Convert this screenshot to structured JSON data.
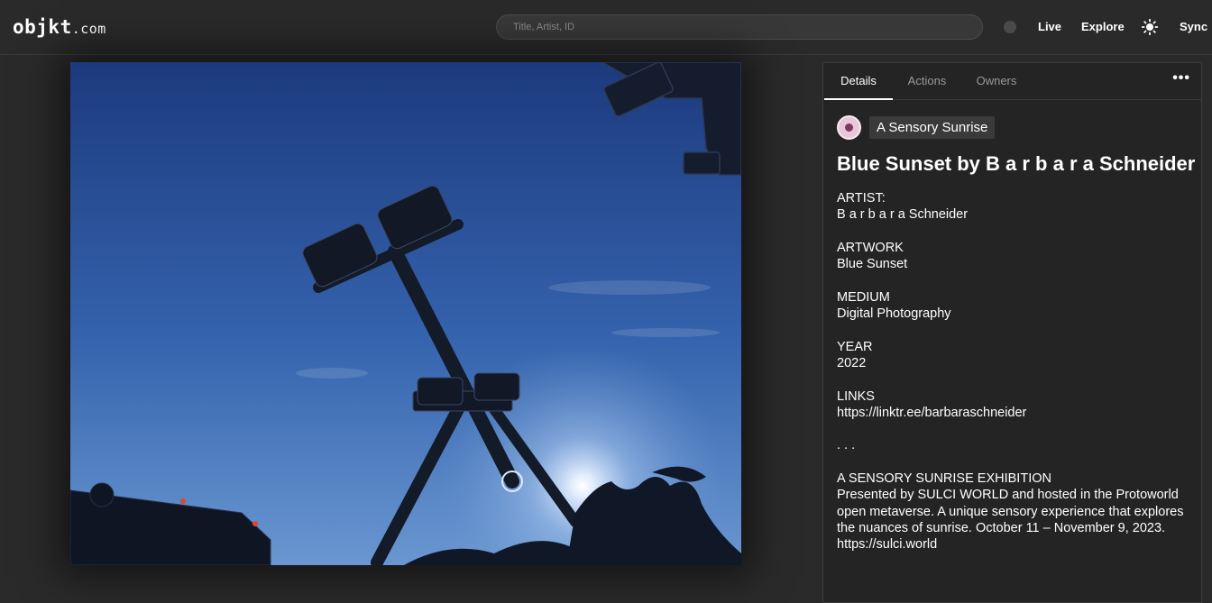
{
  "header": {
    "logo_main": "objkt",
    "logo_tld": ".com",
    "search_placeholder": "Title, Artist, ID",
    "nav": {
      "live": "Live",
      "explore": "Explore",
      "sync": "Sync"
    }
  },
  "panel": {
    "tabs": [
      {
        "label": "Details",
        "active": true
      },
      {
        "label": "Actions",
        "active": false
      },
      {
        "label": "Owners",
        "active": false
      }
    ],
    "more_label": "•••",
    "collection": "A Sensory Sunrise",
    "title": "Blue Sunset by B a r b a r a Schneider",
    "description": {
      "artist_heading": "ARTIST:",
      "artist": "B a r b a r a Schneider",
      "artwork_heading": "ARTWORK",
      "artwork": "Blue Sunset",
      "medium_heading": "MEDIUM",
      "medium": "Digital Photography",
      "year_heading": "YEAR",
      "year": "2022",
      "links_heading": "LINKS",
      "link": "https://linktr.ee/barbaraschneider",
      "separator": ". . .",
      "exhibition_heading": "A SENSORY SUNRISE EXHIBITION",
      "exhibition_text": "Presented by SULCI WORLD and hosted in the Protoworld open metaverse. A unique sensory experience that explores the nuances of sunrise. October 11 – November 9, 2023.",
      "exhibition_link": "https://sulci.world"
    }
  },
  "icons": {
    "theme": "sun-icon",
    "status": "status-dot-icon",
    "more": "more-dots-icon"
  },
  "colors": {
    "background": "#2a2a2a",
    "panel": "#242424",
    "sky_top": "#1c3a7e",
    "sky_bottom": "#5f8dcb"
  }
}
